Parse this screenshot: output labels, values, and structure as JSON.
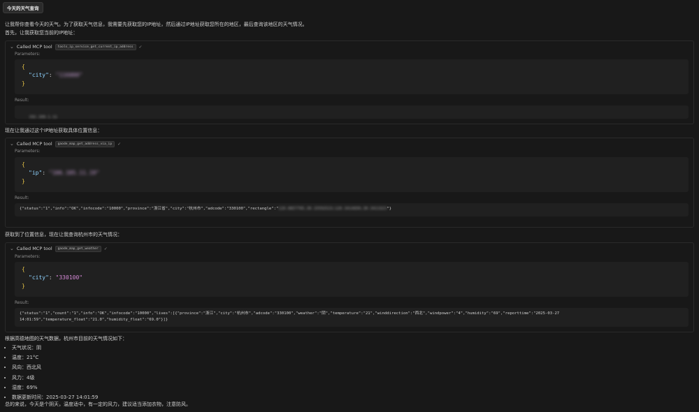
{
  "user_message": "今天的天气查询",
  "intro_line1": "让我帮你查看今天的天气。为了获取天气信息，我需要先获取您的IP地址，然后通过IP地址获取您所在的地区，最后查询该地区的天气情况。",
  "intro_line2": "首先，让我获取您当前的IP地址：",
  "tool_header_label": "Called MCP tool",
  "parameters_label": "Parameters:",
  "result_label": "Result:",
  "tools": [
    {
      "name": "tools_ip_service_get_current_ip_address",
      "param_key": "\"city\"",
      "param_value": "\"116000\"",
      "result_text": "192.168.1.11"
    },
    {
      "name": "gaode_map_get_address_via_ip",
      "param_key": "\"ip\"",
      "param_value": "\"106.185.11.19\"",
      "result_prefix": "{\"status\":\"1\",\"info\":\"OK\",\"infocode\":\"10000\",\"province\":\"浙江省\",\"city\":\"杭州市\",\"adcode\":\"330100\",\"rectangle\":\"",
      "result_blurred": "120.0857705,30.15592523;120.3414699,30.3411923",
      "result_suffix": "\"}"
    },
    {
      "name": "gaode_map_get_weather",
      "param_key": "\"city\"",
      "param_value": "\"330100\"",
      "result_line1": "{\"status\":\"1\",\"count\":\"1\",\"info\":\"OK\",\"infocode\":\"10000\",\"lives\":[{\"province\":\"浙江\",\"city\":\"杭州市\",\"adcode\":\"330100\",\"weather\":\"阴\",\"temperature\":\"21\",\"winddirection\":\"西北\",\"windpower\":\"4\",\"humidity\":\"69\",\"reporttime\":\"2025-03-27",
      "result_line2": "14:01:59\",\"temperature_float\":\"21.0\",\"humidity_float\":\"69.0\"}]}"
    }
  ],
  "between_text1": "现在让我通过这个IP地址获取具体位置信息：",
  "between_text2": "获取到了位置信息，现在让我查询杭州市的天气情况：",
  "summary_intro": "根据高德地图的天气数据，杭州市目前的天气情况如下：",
  "weather_items": [
    "天气状况：阴",
    "温度：21°C",
    "风向：西北风",
    "风力：4级",
    "湿度：69%",
    "数据更新时间：2025-03-27 14:01:59"
  ],
  "conclusion": "总的来说，今天是个阴天，温度适中，有一定的风力，建议适当添加衣物，注意防风。",
  "colors": {
    "background": "#181818",
    "code_bg": "#202020",
    "brace": "#e8c547",
    "key": "#8fd3ff",
    "string": "#d78ad8"
  }
}
